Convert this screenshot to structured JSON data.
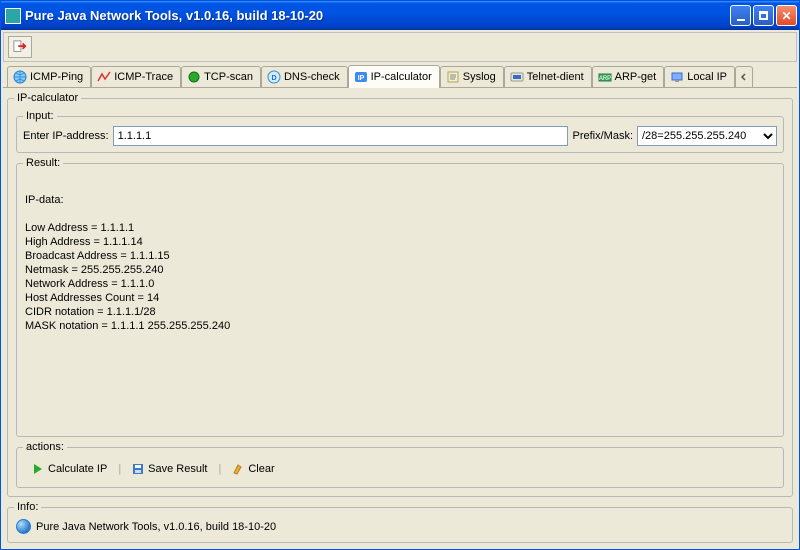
{
  "window": {
    "title": "Pure Java Network Tools,  v1.0.16, build 18-10-20"
  },
  "icons": {
    "exit": "exit-icon"
  },
  "tabs": [
    {
      "label": "ICMP-Ping",
      "icon": "globe-icon",
      "active": false
    },
    {
      "label": "ICMP-Trace",
      "icon": "trace-icon",
      "active": false
    },
    {
      "label": "TCP-scan",
      "icon": "green-dot-icon",
      "active": false
    },
    {
      "label": "DNS-check",
      "icon": "dns-icon",
      "active": false
    },
    {
      "label": "IP-calculator",
      "icon": "ip-icon",
      "active": true
    },
    {
      "label": "Syslog",
      "icon": "syslog-icon",
      "active": false
    },
    {
      "label": "Telnet-dient",
      "icon": "telnet-icon",
      "active": false
    },
    {
      "label": "ARP-get",
      "icon": "arp-icon",
      "active": false
    },
    {
      "label": "Local IP",
      "icon": "localip-icon",
      "active": false
    }
  ],
  "panel": {
    "legend": "IP-calculator",
    "input": {
      "legend": "Input:",
      "ip_label": "Enter IP-address:",
      "ip_value": "1.1.1.1",
      "mask_label": "Prefix/Mask:",
      "mask_value": "/28=255.255.255.240"
    },
    "result": {
      "legend": "Result:",
      "text": "\nIP-data:\n\nLow Address = 1.1.1.1\nHigh Address = 1.1.1.14\nBroadcast Address = 1.1.1.15\nNetmask = 255.255.255.240\nNetwork Address = 1.1.1.0\nHost Addresses Count = 14\nCIDR notation = 1.1.1.1/28\nMASK notation = 1.1.1.1 255.255.255.240"
    },
    "actions": {
      "legend": "actions:",
      "calc": "Calculate IP",
      "save": "Save Result",
      "clear": "Clear"
    }
  },
  "info": {
    "legend": "Info:",
    "text": "Pure Java Network Tools,  v1.0.16, build 18-10-20"
  }
}
